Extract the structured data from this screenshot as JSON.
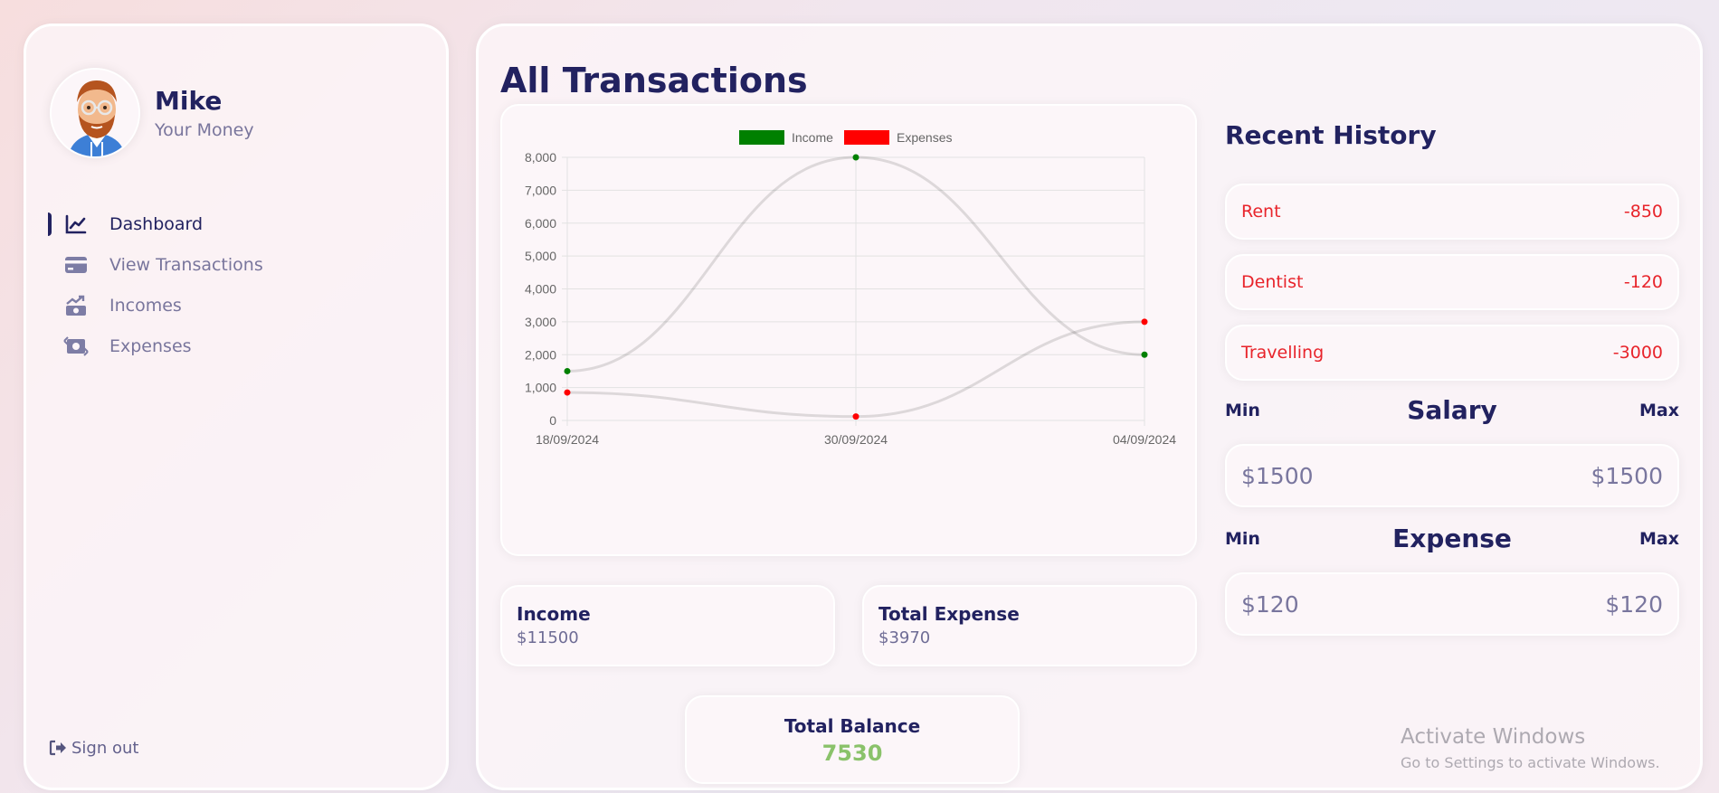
{
  "user": {
    "name": "Mike",
    "subtitle": "Your Money"
  },
  "nav": {
    "items": [
      {
        "label": "Dashboard",
        "icon": "chart-line-icon",
        "active": true
      },
      {
        "label": "View Transactions",
        "icon": "credit-card-icon",
        "active": false
      },
      {
        "label": "Incomes",
        "icon": "money-bill-trend-up-icon",
        "active": false
      },
      {
        "label": "Expenses",
        "icon": "money-bill-transfer-icon",
        "active": false
      }
    ],
    "signout_label": "Sign out"
  },
  "page": {
    "title": "All Transactions"
  },
  "chart_data": {
    "type": "line",
    "categories": [
      "18/09/2024",
      "30/09/2024",
      "04/09/2024"
    ],
    "series": [
      {
        "name": "Income",
        "values": [
          1500,
          8000,
          2000
        ],
        "color": "#008000"
      },
      {
        "name": "Expenses",
        "values": [
          850,
          120,
          3000
        ],
        "color": "#ff0000"
      }
    ],
    "ylim": [
      0,
      8000
    ],
    "yticks": [
      "0",
      "1,000",
      "2,000",
      "3,000",
      "4,000",
      "5,000",
      "6,000",
      "7,000",
      "8,000"
    ],
    "grid": true,
    "legend": "top-center",
    "title": "",
    "xlabel": "",
    "ylabel": ""
  },
  "stats": {
    "income_label": "Income",
    "income_value": "$11500",
    "expense_label": "Total Expense",
    "expense_value": "$3970",
    "balance_label": "Total Balance",
    "balance_value": "7530"
  },
  "history": {
    "title": "Recent History",
    "items": [
      {
        "title": "Rent",
        "amount": "-850"
      },
      {
        "title": "Dentist",
        "amount": "-120"
      },
      {
        "title": "Travelling",
        "amount": "-3000"
      }
    ]
  },
  "salary": {
    "title": "Salary",
    "min_label": "Min",
    "max_label": "Max",
    "min": "$1500",
    "max": "$1500"
  },
  "expense_range": {
    "title": "Expense",
    "min_label": "Min",
    "max_label": "Max",
    "min": "$120",
    "max": "$120"
  },
  "watermark": {
    "title": "Activate Windows",
    "subtitle": "Go to Settings to activate Windows."
  },
  "colors": {
    "text": "#222260",
    "negative": "#e8242b",
    "balance": "#8ac26a",
    "income": "#008000",
    "expense": "#ff0000"
  }
}
